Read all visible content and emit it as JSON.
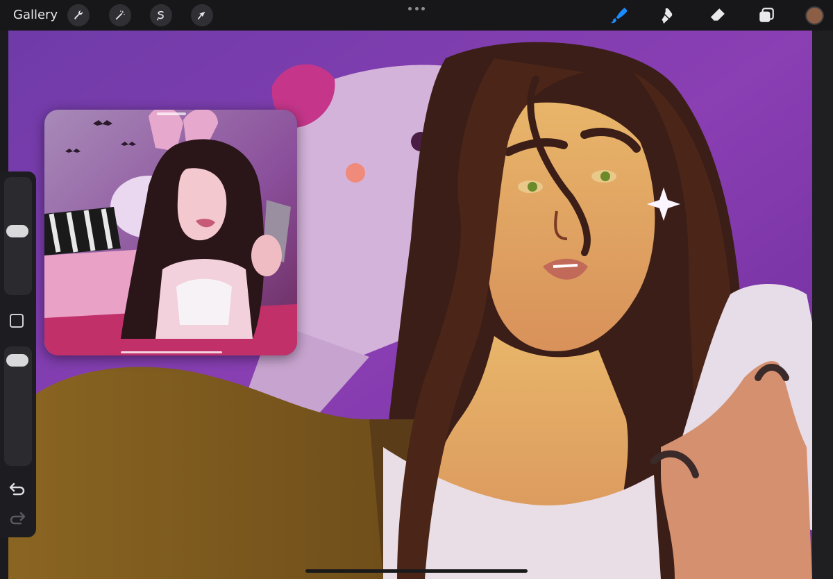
{
  "toolbar": {
    "gallery_label": "Gallery",
    "actions": [
      {
        "name": "wrench-icon"
      },
      {
        "name": "magic-wand-icon"
      },
      {
        "name": "selection-icon"
      },
      {
        "name": "transform-arrow-icon"
      }
    ],
    "right_tools": [
      {
        "name": "brush-icon",
        "active": true
      },
      {
        "name": "smudge-icon",
        "active": false
      },
      {
        "name": "eraser-icon",
        "active": false
      },
      {
        "name": "layers-icon",
        "active": false
      }
    ],
    "current_color": "#8b5e45",
    "accent_color": "#1a8cff"
  },
  "sidebar": {
    "size_slider_level": 0.55,
    "opacity_slider_level": 0.95,
    "undo_icon": "undo-arrow-icon",
    "redo_icon": "redo-arrow-icon"
  },
  "reference": {
    "icon": "reference-photo"
  }
}
